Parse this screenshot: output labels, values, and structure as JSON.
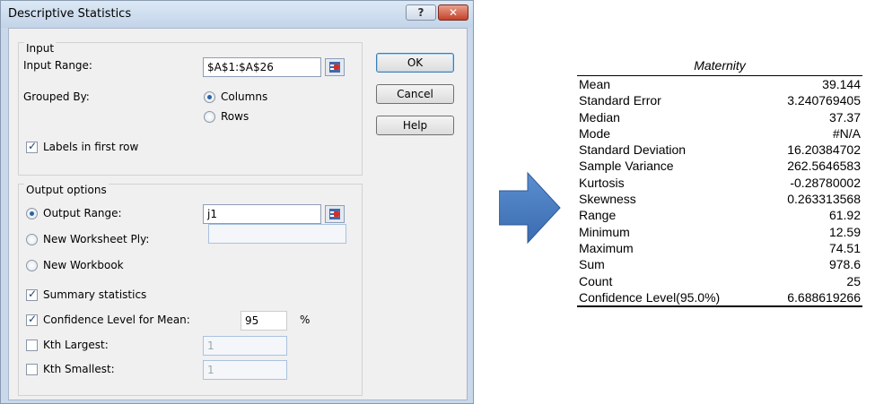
{
  "dialog": {
    "title": "Descriptive Statistics",
    "title_buttons": {
      "help": "?",
      "close": "✕"
    },
    "input_group": {
      "title": "Input",
      "input_range_label": "Input Range:",
      "input_range_value": "$A$1:$A$26",
      "grouped_by_label": "Grouped By:",
      "columns_label": "Columns",
      "rows_label": "Rows",
      "grouped_by_selected": "Columns",
      "labels_first_row": "Labels in first row",
      "labels_first_row_checked": true
    },
    "output_group": {
      "title": "Output options",
      "output_range_label": "Output Range:",
      "output_range_value": "j1",
      "new_ply_label": "New Worksheet Ply:",
      "new_workbook_label": "New Workbook",
      "selected": "Output Range",
      "summary_stats_label": "Summary statistics",
      "summary_stats_checked": true,
      "confidence_label": "Confidence Level for Mean:",
      "confidence_checked": true,
      "confidence_value": "95",
      "percent_sign": "%",
      "kth_largest_label": "Kth Largest:",
      "kth_largest_value": "1",
      "kth_largest_checked": false,
      "kth_smallest_label": "Kth Smallest:",
      "kth_smallest_value": "1",
      "kth_smallest_checked": false
    },
    "buttons": {
      "ok": "OK",
      "cancel": "Cancel",
      "help": "Help"
    }
  },
  "arrow": {
    "icon": "right-arrow-icon",
    "color": "#4a7ebb"
  },
  "results": {
    "header": "Maternity",
    "rows": [
      {
        "label": "Mean",
        "value": "39.144"
      },
      {
        "label": "Standard Error",
        "value": "3.240769405"
      },
      {
        "label": "Median",
        "value": "37.37"
      },
      {
        "label": "Mode",
        "value": "#N/A"
      },
      {
        "label": "Standard Deviation",
        "value": "16.20384702"
      },
      {
        "label": "Sample Variance",
        "value": "262.5646583"
      },
      {
        "label": "Kurtosis",
        "value": "-0.28780002"
      },
      {
        "label": "Skewness",
        "value": "0.263313568"
      },
      {
        "label": "Range",
        "value": "61.92"
      },
      {
        "label": "Minimum",
        "value": "12.59"
      },
      {
        "label": "Maximum",
        "value": "74.51"
      },
      {
        "label": "Sum",
        "value": "978.6"
      },
      {
        "label": "Count",
        "value": "25"
      },
      {
        "label": "Confidence Level(95.0%)",
        "value": "6.688619266"
      }
    ]
  }
}
